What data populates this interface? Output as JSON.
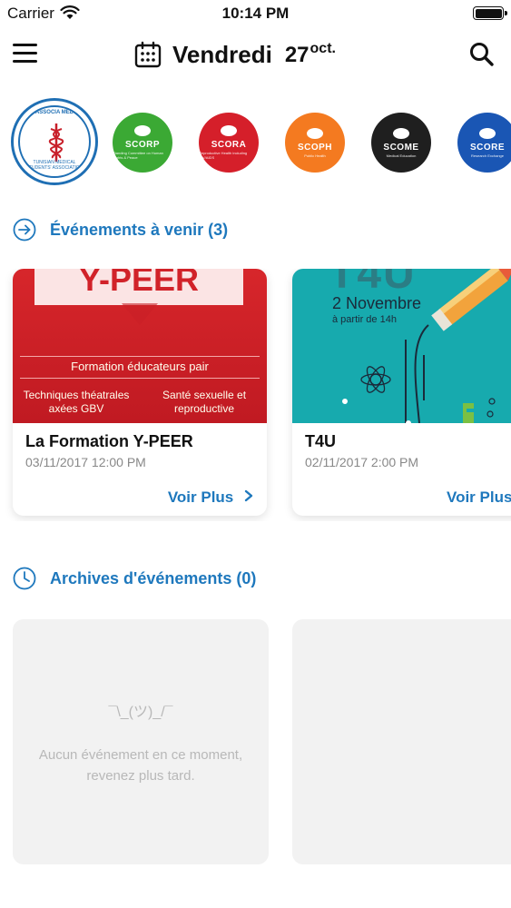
{
  "status_bar": {
    "carrier": "Carrier",
    "time": "10:14 PM",
    "battery_level_percent": 100
  },
  "nav": {
    "day_name": "Vendredi",
    "day_number": "27",
    "month": "oct.",
    "menu_icon": "hamburger-menu-icon",
    "calendar_icon": "calendar-icon",
    "search_icon": "search-icon"
  },
  "associations": {
    "main": {
      "top_text": "ASSOCIA MED",
      "bottom_text": "TUNISIAN MEDICAL STUDENTS' ASSOCIATION",
      "color": "#1f6fb4"
    },
    "committees": [
      {
        "name": "SCORP",
        "sub": "Standing Committee on Human Rights & Peace",
        "color": "#3ba934"
      },
      {
        "name": "SCORA",
        "sub": "Reproductive Health including HIV/AIDS",
        "color": "#d51f2a"
      },
      {
        "name": "SCOPH",
        "sub": "Public Health",
        "color": "#f47a20"
      },
      {
        "name": "SCOME",
        "sub": "Medical Education",
        "color": "#1f1f1f"
      },
      {
        "name": "SCORE",
        "sub": "Research Exchange",
        "color": "#1a56b4"
      }
    ]
  },
  "upcoming": {
    "title": "Événements à venir (3)",
    "icon": "arrow-right-circle-icon",
    "accent": "#1e78bd",
    "events": [
      {
        "title": "La Formation Y-PEER",
        "date": "03/11/2017 12:00 PM",
        "more": "Voir Plus",
        "poster": {
          "banner": "Y-PEER",
          "line1": "Formation éducateurs pair",
          "left": "Techniques théatrales axées GBV",
          "right": "Santé sexuelle et reproductive"
        }
      },
      {
        "title": "T4U",
        "date": "02/11/2017 2:00 PM",
        "more": "Voir Plus",
        "poster": {
          "big": "T4U",
          "date": "2 Novembre",
          "from": "à partir de 14h"
        }
      }
    ]
  },
  "archives": {
    "title": "Archives d'événements (0)",
    "icon": "clock-icon",
    "shrug": "¯\\_(ツ)_/¯",
    "empty_message": "Aucun événement en ce moment, revenez plus tard."
  }
}
